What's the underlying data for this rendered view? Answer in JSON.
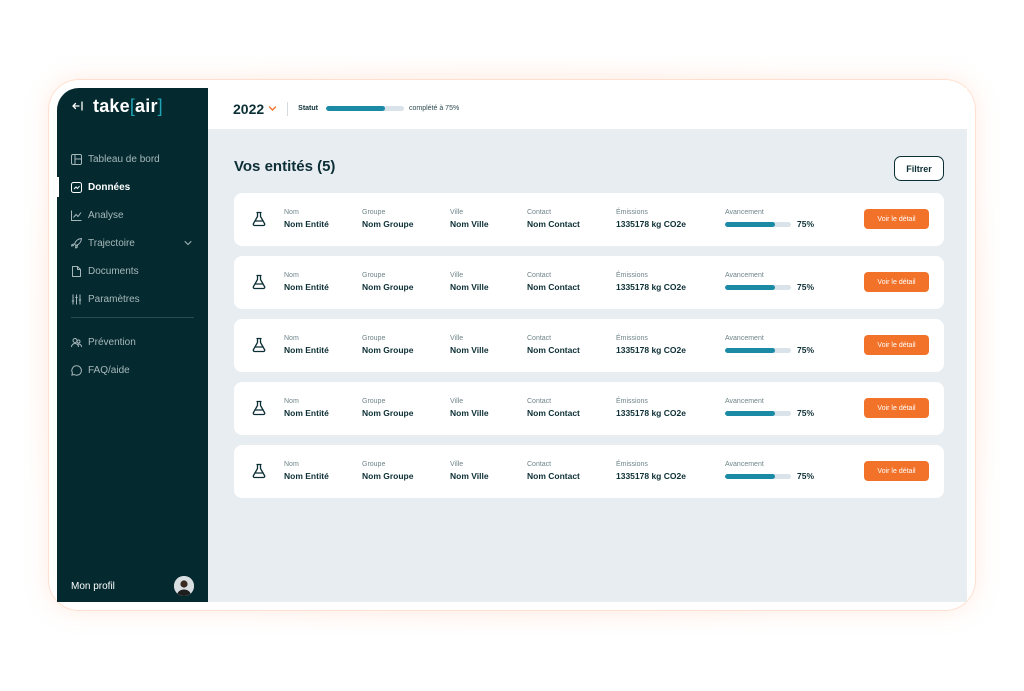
{
  "app": {
    "logo_main": "take",
    "logo_open": "[",
    "logo_accent": "air",
    "logo_close": "]"
  },
  "sidebar": {
    "items": [
      {
        "label": "Tableau de bord",
        "icon": "dashboard-icon"
      },
      {
        "label": "Données",
        "icon": "data-icon",
        "active": true
      },
      {
        "label": "Analyse",
        "icon": "chart-line-icon"
      },
      {
        "label": "Trajectoire",
        "icon": "rocket-icon",
        "expandable": true
      },
      {
        "label": "Documents",
        "icon": "document-icon"
      },
      {
        "label": "Paramètres",
        "icon": "sliders-icon"
      }
    ],
    "secondary_items": [
      {
        "label": "Prévention",
        "icon": "users-icon"
      },
      {
        "label": "FAQ/aide",
        "icon": "chat-icon"
      }
    ],
    "profile_label": "Mon profil"
  },
  "topbar": {
    "year": "2022",
    "status_label": "Statut",
    "status_progress": 0.75,
    "status_text": "complété à 75%"
  },
  "main": {
    "title": "Vos entités (5)",
    "filter_label": "Filtrer",
    "column_labels": {
      "nom": "Nom",
      "groupe": "Groupe",
      "ville": "Ville",
      "contact": "Contact",
      "emissions": "Émissions",
      "avancement": "Avancement"
    },
    "detail_label": "Voir le détail",
    "entities": [
      {
        "nom": "Nom Entité",
        "groupe": "Nom Groupe",
        "ville": "Nom Ville",
        "contact": "Nom Contact",
        "emissions": "1335178 kg CO2e",
        "avancement": 0.75,
        "avancement_label": "75%"
      },
      {
        "nom": "Nom Entité",
        "groupe": "Nom Groupe",
        "ville": "Nom Ville",
        "contact": "Nom Contact",
        "emissions": "1335178 kg CO2e",
        "avancement": 0.75,
        "avancement_label": "75%"
      },
      {
        "nom": "Nom Entité",
        "groupe": "Nom Groupe",
        "ville": "Nom Ville",
        "contact": "Nom Contact",
        "emissions": "1335178 kg CO2e",
        "avancement": 0.75,
        "avancement_label": "75%"
      },
      {
        "nom": "Nom Entité",
        "groupe": "Nom Groupe",
        "ville": "Nom Ville",
        "contact": "Nom Contact",
        "emissions": "1335178 kg CO2e",
        "avancement": 0.75,
        "avancement_label": "75%"
      },
      {
        "nom": "Nom Entité",
        "groupe": "Nom Groupe",
        "ville": "Nom Ville",
        "contact": "Nom Contact",
        "emissions": "1335178 kg CO2e",
        "avancement": 0.75,
        "avancement_label": "75%"
      }
    ]
  },
  "colors": {
    "sidebar_bg": "#042a2f",
    "accent_teal": "#1a8aa5",
    "accent_orange": "#f27229",
    "content_bg": "#e8edf2"
  }
}
